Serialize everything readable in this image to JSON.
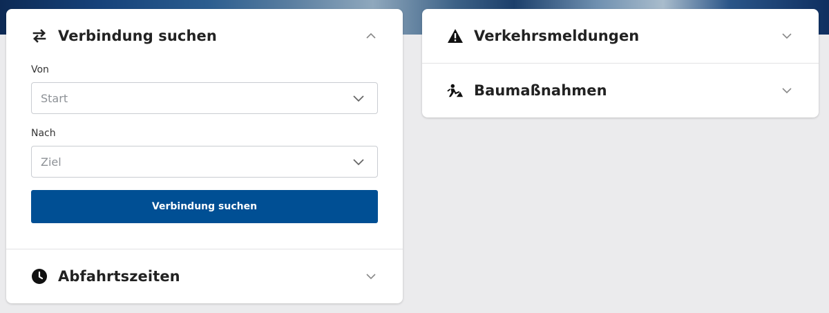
{
  "colors": {
    "primary": "#004f94",
    "background": "#ebebed",
    "card": "#ffffff",
    "text": "#222222",
    "placeholder": "#8d9196"
  },
  "connection": {
    "title": "Verbindung suchen",
    "icon": "swap-arrows-icon",
    "expanded": true,
    "from_label": "Von",
    "from_placeholder": "Start",
    "to_label": "Nach",
    "to_placeholder": "Ziel",
    "submit_label": "Verbindung suchen"
  },
  "departures": {
    "title": "Abfahrtszeiten",
    "icon": "clock-icon",
    "expanded": false
  },
  "traffic": {
    "title": "Verkehrsmeldungen",
    "icon": "warning-icon",
    "expanded": false
  },
  "construction": {
    "title": "Baumaßnahmen",
    "icon": "construction-worker-icon",
    "expanded": false
  }
}
